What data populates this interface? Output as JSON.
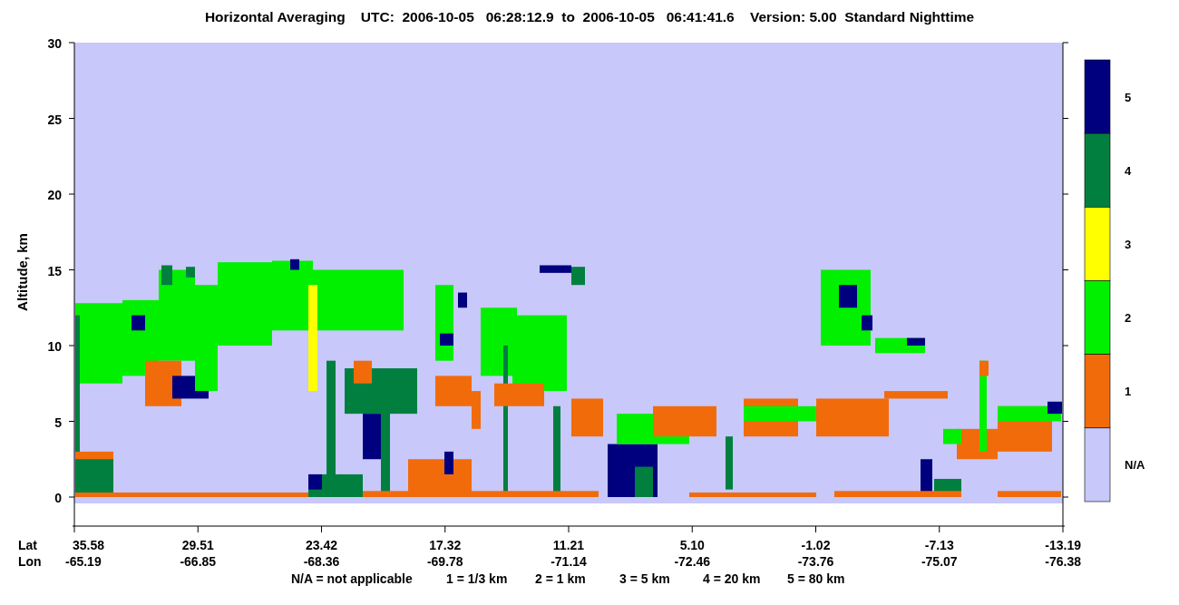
{
  "title": "Horizontal Averaging    UTC:  2006-10-05   06:28:12.9  to  2006-10-05   06:41:41.6    Version: 5.00  Standard Nighttime",
  "y_axis": {
    "label": "Altitude, km",
    "ticks": [
      "30",
      "25",
      "20",
      "15",
      "10",
      "5",
      "0"
    ]
  },
  "x_axis": {
    "row_labels": [
      "Lat",
      "Lon"
    ],
    "ticks": [
      {
        "lat": "35.58",
        "lon": "-65.19"
      },
      {
        "lat": "29.51",
        "lon": "-66.85"
      },
      {
        "lat": "23.42",
        "lon": "-68.36"
      },
      {
        "lat": "17.32",
        "lon": "-69.78"
      },
      {
        "lat": "11.21",
        "lon": "-71.14"
      },
      {
        "lat": "5.10",
        "lon": "-72.46"
      },
      {
        "lat": "-1.02",
        "lon": "-73.76"
      },
      {
        "lat": "-7.13",
        "lon": "-75.07"
      },
      {
        "lat": "-13.19",
        "lon": "-76.38"
      }
    ]
  },
  "colorbar": {
    "levels": [
      {
        "label": "5",
        "color": "#00007f"
      },
      {
        "label": "4",
        "color": "#007f3f"
      },
      {
        "label": "3",
        "color": "#ffff00"
      },
      {
        "label": "2",
        "color": "#00f000"
      },
      {
        "label": "1",
        "color": "#f26b0a"
      },
      {
        "label": "N/A",
        "color": "#c8c8fa"
      }
    ]
  },
  "legend": [
    "N/A = not applicable",
    "1 = 1/3 km",
    "2 = 1 km",
    "3 = 5 km",
    "4 = 20 km",
    "5 = 80 km"
  ]
}
